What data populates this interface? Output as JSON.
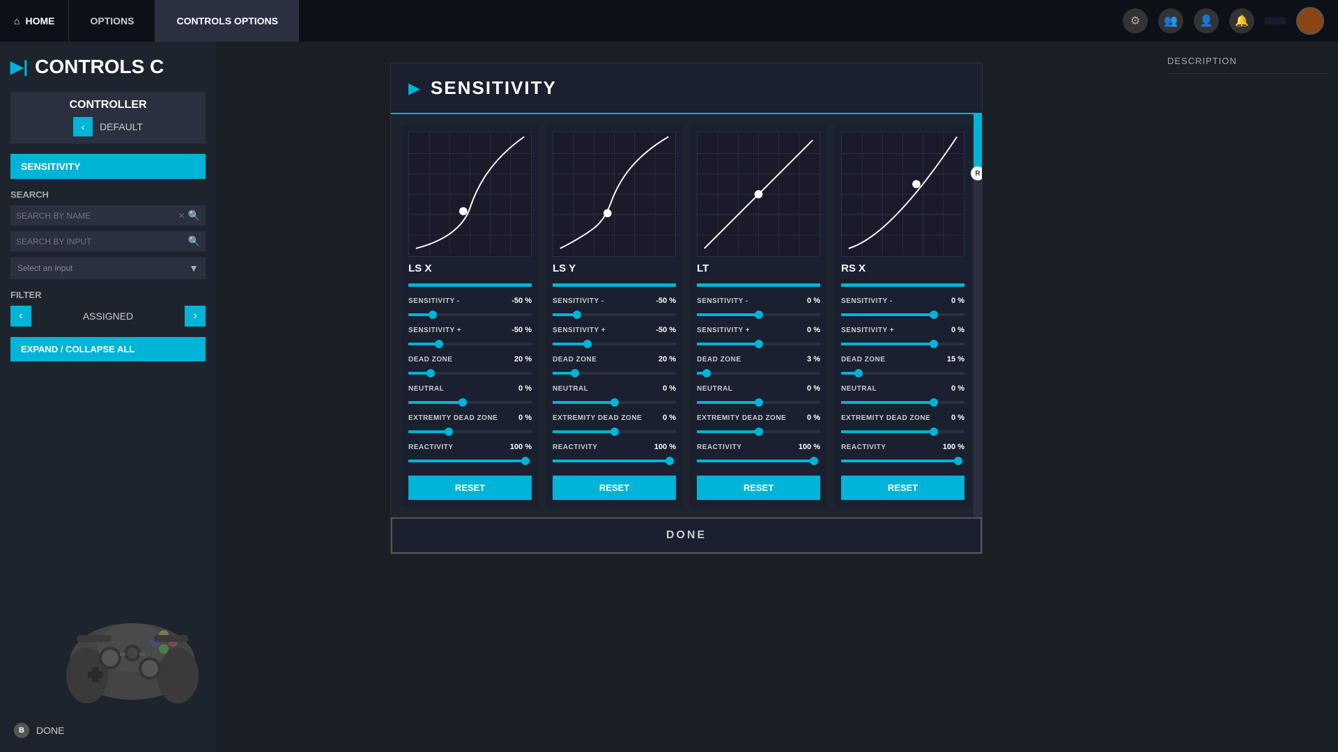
{
  "topbar": {
    "home_label": "HOME",
    "options_label": "OPTIONS",
    "controls_options_label": "CONTROLS OPTIONS",
    "username_label": ""
  },
  "sidebar": {
    "title": "CONTROLS C",
    "title_arrow": "▶|",
    "controller_label": "CONTROLLER",
    "controller_default": "DEFAULT",
    "sensitivity_label": "SENSITIVITY",
    "search_label": "SEARCH",
    "search_by_name_placeholder": "SEARCH BY NAME",
    "search_by_input_placeholder": "SEARCH BY INPUT",
    "select_input_label": "Select an input",
    "filter_label": "FILTER",
    "filter_value": "ASSIGNED",
    "expand_collapse_label": "EXPAND / COLLAPSE ALL",
    "bottom_done_label": "DONE",
    "b_button_label": "B"
  },
  "modal": {
    "title": "SENSITIVITY",
    "title_arrow": "▶",
    "done_label": "DONE",
    "cards": [
      {
        "id": "ls-x",
        "label": "LS X",
        "progress": 100,
        "controls": [
          {
            "name": "SENSITIVITY -",
            "value": "-50 %",
            "fill_pct": 20,
            "thumb_pct": 20
          },
          {
            "name": "SENSITIVITY +",
            "value": "-50 %",
            "fill_pct": 30,
            "thumb_pct": 30
          },
          {
            "name": "DEAD ZONE",
            "value": "20 %",
            "fill_pct": 20,
            "thumb_pct": 20
          },
          {
            "name": "NEUTRAL",
            "value": "0 %",
            "fill_pct": 45,
            "thumb_pct": 45
          },
          {
            "name": "EXTREMITY DEAD ZONE",
            "value": "0 %",
            "fill_pct": 35,
            "thumb_pct": 35
          },
          {
            "name": "REACTIVITY",
            "value": "100 %",
            "fill_pct": 95,
            "thumb_pct": 95
          }
        ],
        "reset_label": "RESET",
        "curve_type": "exponential"
      },
      {
        "id": "ls-y",
        "label": "LS Y",
        "progress": 100,
        "controls": [
          {
            "name": "SENSITIVITY -",
            "value": "-50 %",
            "fill_pct": 20,
            "thumb_pct": 20
          },
          {
            "name": "SENSITIVITY +",
            "value": "-50 %",
            "fill_pct": 30,
            "thumb_pct": 30
          },
          {
            "name": "DEAD ZONE",
            "value": "20 %",
            "fill_pct": 20,
            "thumb_pct": 20
          },
          {
            "name": "NEUTRAL",
            "value": "0 %",
            "fill_pct": 50,
            "thumb_pct": 50
          },
          {
            "name": "EXTREMITY DEAD ZONE",
            "value": "0 %",
            "fill_pct": 50,
            "thumb_pct": 50
          },
          {
            "name": "REACTIVITY",
            "value": "100 %",
            "fill_pct": 95,
            "thumb_pct": 95
          }
        ],
        "reset_label": "RESET",
        "curve_type": "s-curve"
      },
      {
        "id": "lt",
        "label": "LT",
        "progress": 100,
        "controls": [
          {
            "name": "SENSITIVITY -",
            "value": "0 %",
            "fill_pct": 50,
            "thumb_pct": 50
          },
          {
            "name": "SENSITIVITY +",
            "value": "0 %",
            "fill_pct": 50,
            "thumb_pct": 50
          },
          {
            "name": "DEAD ZONE",
            "value": "3 %",
            "fill_pct": 8,
            "thumb_pct": 8
          },
          {
            "name": "NEUTRAL",
            "value": "0 %",
            "fill_pct": 50,
            "thumb_pct": 50
          },
          {
            "name": "EXTREMITY DEAD ZONE",
            "value": "0 %",
            "fill_pct": 50,
            "thumb_pct": 50
          },
          {
            "name": "REACTIVITY",
            "value": "100 %",
            "fill_pct": 95,
            "thumb_pct": 95
          }
        ],
        "reset_label": "RESET",
        "curve_type": "linear"
      },
      {
        "id": "rs-x",
        "label": "RS X",
        "progress": 100,
        "controls": [
          {
            "name": "SENSITIVITY -",
            "value": "0 %",
            "fill_pct": 75,
            "thumb_pct": 75
          },
          {
            "name": "SENSITIVITY +",
            "value": "0 %",
            "fill_pct": 75,
            "thumb_pct": 75
          },
          {
            "name": "DEAD ZONE",
            "value": "15 %",
            "fill_pct": 15,
            "thumb_pct": 15
          },
          {
            "name": "NEUTRAL",
            "value": "0 %",
            "fill_pct": 75,
            "thumb_pct": 75
          },
          {
            "name": "EXTREMITY DEAD ZONE",
            "value": "0 %",
            "fill_pct": 75,
            "thumb_pct": 75
          },
          {
            "name": "REACTIVITY",
            "value": "100 %",
            "fill_pct": 95,
            "thumb_pct": 95
          }
        ],
        "reset_label": "RESET",
        "curve_type": "linear-steep"
      }
    ]
  },
  "right_panel": {
    "description_label": "DESCRIPTION"
  }
}
